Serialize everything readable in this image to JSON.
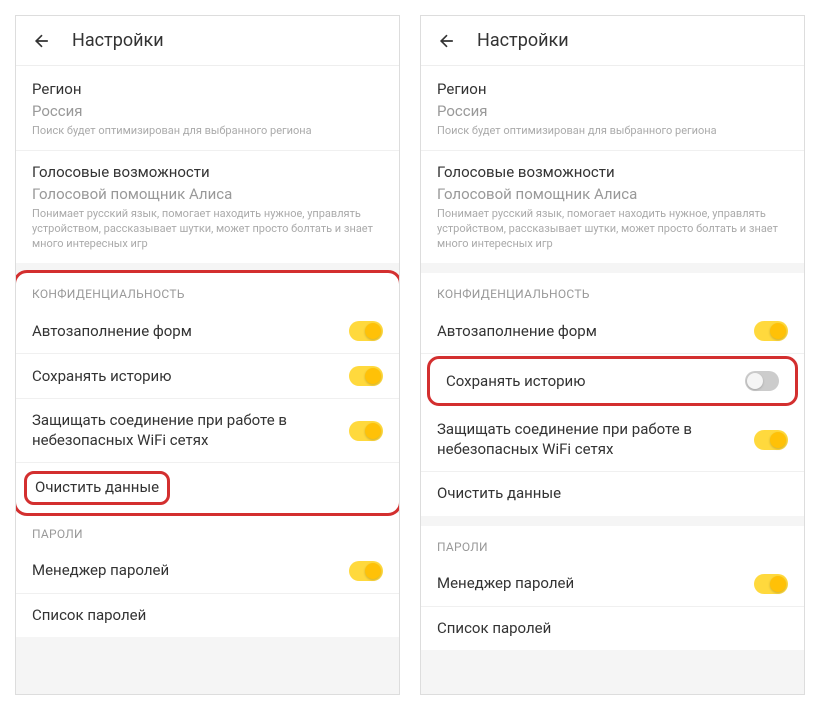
{
  "header": {
    "title": "Настройки"
  },
  "region": {
    "label": "Регион",
    "value": "Россия",
    "desc": "Поиск будет оптимизирован для выбранного региона"
  },
  "voice": {
    "label": "Голосовые возможности",
    "value": "Голосовой помощник Алиса",
    "desc": "Понимает русский язык, помогает находить нужное, управлять устройством, рассказывает шутки, может просто болтать и знает много интересных игр"
  },
  "privacy": {
    "header": "КОНФИДЕНЦИАЛЬНОСТЬ",
    "autofill": "Автозаполнение форм",
    "saveHistory": "Сохранять историю",
    "protectWifi": "Защищать соединение при работе в небезопасных WiFi сетях",
    "clearData": "Очистить данные"
  },
  "passwords": {
    "header": "ПАРОЛИ",
    "manager": "Менеджер паролей",
    "list": "Список паролей"
  }
}
